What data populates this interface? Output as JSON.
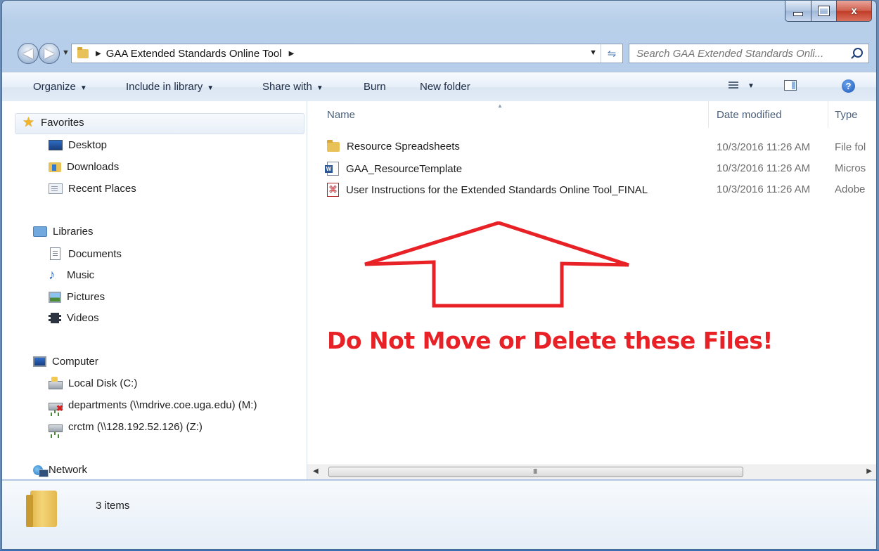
{
  "window": {
    "controls": [
      "minimize",
      "maximize",
      "close"
    ],
    "close_label": "x"
  },
  "navigation": {
    "breadcrumb": "GAA Extended Standards Online Tool",
    "search_placeholder": "Search GAA Extended Standards Onli..."
  },
  "toolbar": {
    "organize": "Organize",
    "include_in_library": "Include in library",
    "share_with": "Share with",
    "burn": "Burn",
    "new_folder": "New folder",
    "icons": [
      "views-icon",
      "preview-pane-icon",
      "help-icon"
    ]
  },
  "sidebar": {
    "favorites": {
      "label": "Favorites",
      "items": [
        {
          "label": "Desktop",
          "icon": "desktop-icon"
        },
        {
          "label": "Downloads",
          "icon": "downloads-icon"
        },
        {
          "label": "Recent Places",
          "icon": "recent-places-icon"
        }
      ]
    },
    "libraries": {
      "label": "Libraries",
      "items": [
        {
          "label": "Documents",
          "icon": "documents-icon"
        },
        {
          "label": "Music",
          "icon": "music-icon"
        },
        {
          "label": "Pictures",
          "icon": "pictures-icon"
        },
        {
          "label": "Videos",
          "icon": "videos-icon"
        }
      ]
    },
    "computer": {
      "label": "Computer",
      "items": [
        {
          "label": "Local Disk (C:)",
          "icon": "local-disk-icon"
        },
        {
          "label": "departments (\\\\mdrive.coe.uga.edu) (M:)",
          "icon": "disconnected-drive-icon"
        },
        {
          "label": "crctm (\\\\128.192.52.126) (Z:)",
          "icon": "network-drive-icon"
        }
      ]
    },
    "network": {
      "label": "Network"
    }
  },
  "columns": {
    "name": "Name",
    "date_modified": "Date modified",
    "type": "Type"
  },
  "files": [
    {
      "name": "Resource Spreadsheets",
      "date": "10/3/2016 11:26 AM",
      "type": "File fol",
      "icon": "folder-icon"
    },
    {
      "name": "GAA_ResourceTemplate",
      "date": "10/3/2016 11:26 AM",
      "type": "Micros",
      "icon": "word-document-icon"
    },
    {
      "name": "User Instructions for the Extended Standards Online Tool_FINAL",
      "date": "10/3/2016 11:26 AM",
      "type": "Adobe",
      "icon": "pdf-icon"
    }
  ],
  "scrollbar_grip": "III",
  "details": {
    "item_count": "3 items"
  },
  "annotation": {
    "text": "Do Not Move or Delete these Files!",
    "color": "#e82127"
  }
}
